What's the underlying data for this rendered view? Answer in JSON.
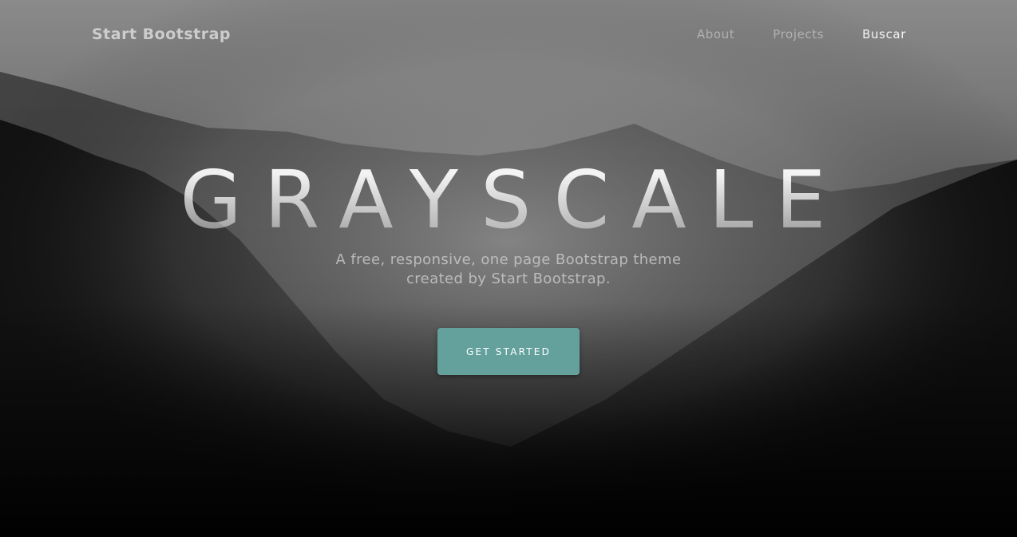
{
  "navbar": {
    "brand": "Start Bootstrap",
    "links": [
      {
        "label": "About"
      },
      {
        "label": "Projects"
      },
      {
        "label": "Buscar"
      }
    ]
  },
  "hero": {
    "title": "GRAYSCALE",
    "subtitle": "A free, responsive, one page Bootstrap theme created by Start Bootstrap.",
    "cta_label": "GET STARTED"
  },
  "colors": {
    "accent": "#64a19d"
  }
}
